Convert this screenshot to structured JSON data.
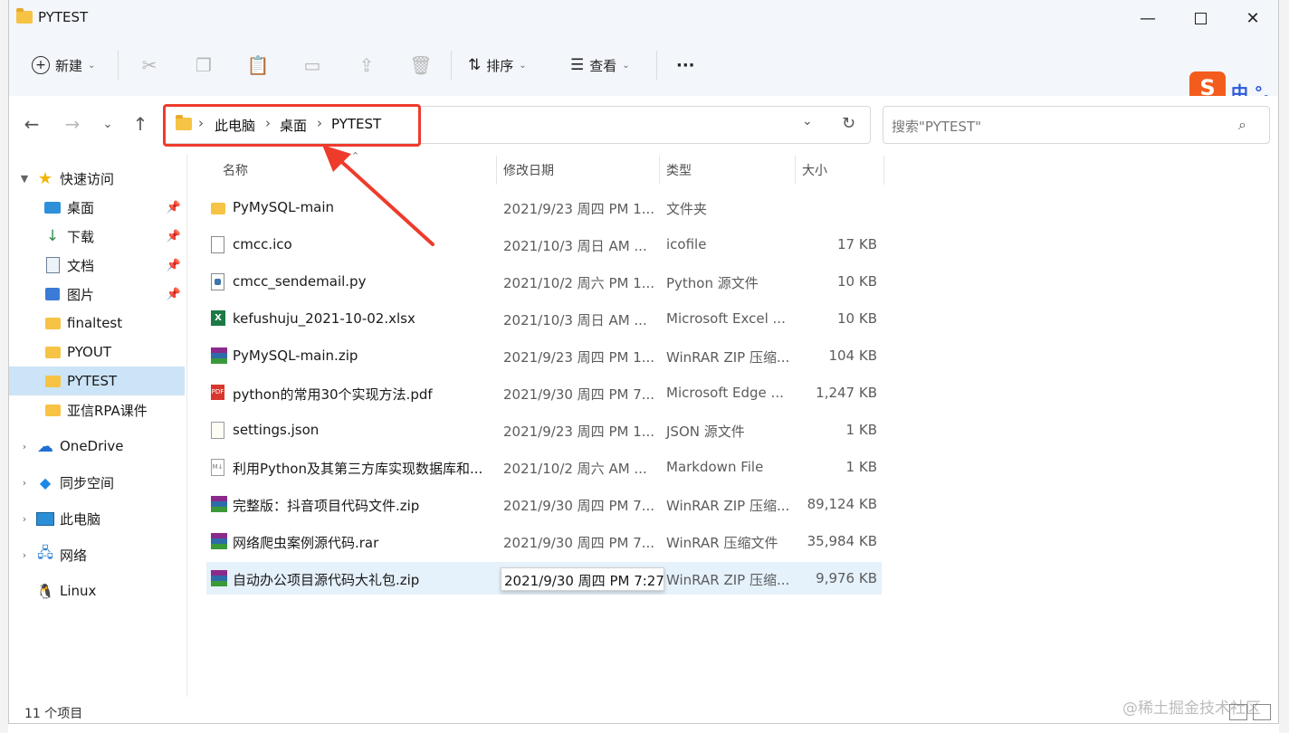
{
  "window": {
    "title": "PYTEST"
  },
  "toolbar": {
    "new_label": "新建",
    "sort_label": "排序",
    "view_label": "查看",
    "more_label": "···"
  },
  "address": {
    "crumbs": [
      "此电脑",
      "桌面",
      "PYTEST"
    ]
  },
  "search": {
    "placeholder": "搜索\"PYTEST\""
  },
  "ime": {
    "logo": "S",
    "text": "中 °,"
  },
  "sidebar": {
    "quick_access": "快速访问",
    "items": [
      {
        "label": "桌面",
        "icon": "desktop-icon"
      },
      {
        "label": "下载",
        "icon": "download-icon"
      },
      {
        "label": "文档",
        "icon": "document-icon"
      },
      {
        "label": "图片",
        "icon": "picture-icon"
      },
      {
        "label": "finaltest",
        "icon": "folder-icon"
      },
      {
        "label": "PYOUT",
        "icon": "folder-icon"
      },
      {
        "label": "PYTEST",
        "icon": "folder-icon"
      },
      {
        "label": "亚信RPA课件",
        "icon": "folder-icon"
      }
    ],
    "onedrive": "OneDrive",
    "sync": "同步空间",
    "thispc": "此电脑",
    "network": "网络",
    "linux": "Linux"
  },
  "columns": {
    "name": "名称",
    "date": "修改日期",
    "type": "类型",
    "size": "大小"
  },
  "files": [
    {
      "name": "PyMySQL-main",
      "date": "2021/9/23 周四 PM 1...",
      "type": "文件夹",
      "size": "",
      "icon": "folder-icon"
    },
    {
      "name": "cmcc.ico",
      "date": "2021/10/3 周日 AM ...",
      "type": "icofile",
      "size": "17 KB",
      "icon": "file-icon"
    },
    {
      "name": "cmcc_sendemail.py",
      "date": "2021/10/2 周六 PM 1...",
      "type": "Python 源文件",
      "size": "10 KB",
      "icon": "python-file-icon"
    },
    {
      "name": "kefushuju_2021-10-02.xlsx",
      "date": "2021/10/3 周日 AM ...",
      "type": "Microsoft Excel ...",
      "size": "10 KB",
      "icon": "excel-icon"
    },
    {
      "name": "PyMySQL-main.zip",
      "date": "2021/9/23 周四 PM 1...",
      "type": "WinRAR ZIP 压缩...",
      "size": "104 KB",
      "icon": "winrar-icon"
    },
    {
      "name": "python的常用30个实现方法.pdf",
      "date": "2021/9/30 周四 PM 7...",
      "type": "Microsoft Edge ...",
      "size": "1,247 KB",
      "icon": "pdf-icon"
    },
    {
      "name": "settings.json",
      "date": "2021/9/23 周四 PM 1...",
      "type": "JSON 源文件",
      "size": "1 KB",
      "icon": "json-icon"
    },
    {
      "name": "利用Python及其第三方库实现数据库和...",
      "date": "2021/10/2 周六 AM ...",
      "type": "Markdown File",
      "size": "1 KB",
      "icon": "markdown-icon"
    },
    {
      "name": "完整版：抖音项目代码文件.zip",
      "date": "2021/9/30 周四 PM 7...",
      "type": "WinRAR ZIP 压缩...",
      "size": "89,124 KB",
      "icon": "winrar-icon"
    },
    {
      "name": "网络爬虫案例源代码.rar",
      "date": "2021/9/30 周四 PM 7...",
      "type": "WinRAR 压缩文件",
      "size": "35,984 KB",
      "icon": "winrar-icon"
    },
    {
      "name": "自动办公项目源代码大礼包.zip",
      "date": "2021/9/30 周四 PM 7:27",
      "type": "WinRAR ZIP 压缩...",
      "size": "9,976 KB",
      "icon": "winrar-icon"
    }
  ],
  "tooltip": "2021/9/30 周四 PM 7:27",
  "status": {
    "count": "11 个项目"
  },
  "watermark": "@稀土掘金技术社区",
  "colors": {
    "accent": "#ee3b2c",
    "selection": "#cce4f7",
    "ime": "#f35c1c"
  }
}
